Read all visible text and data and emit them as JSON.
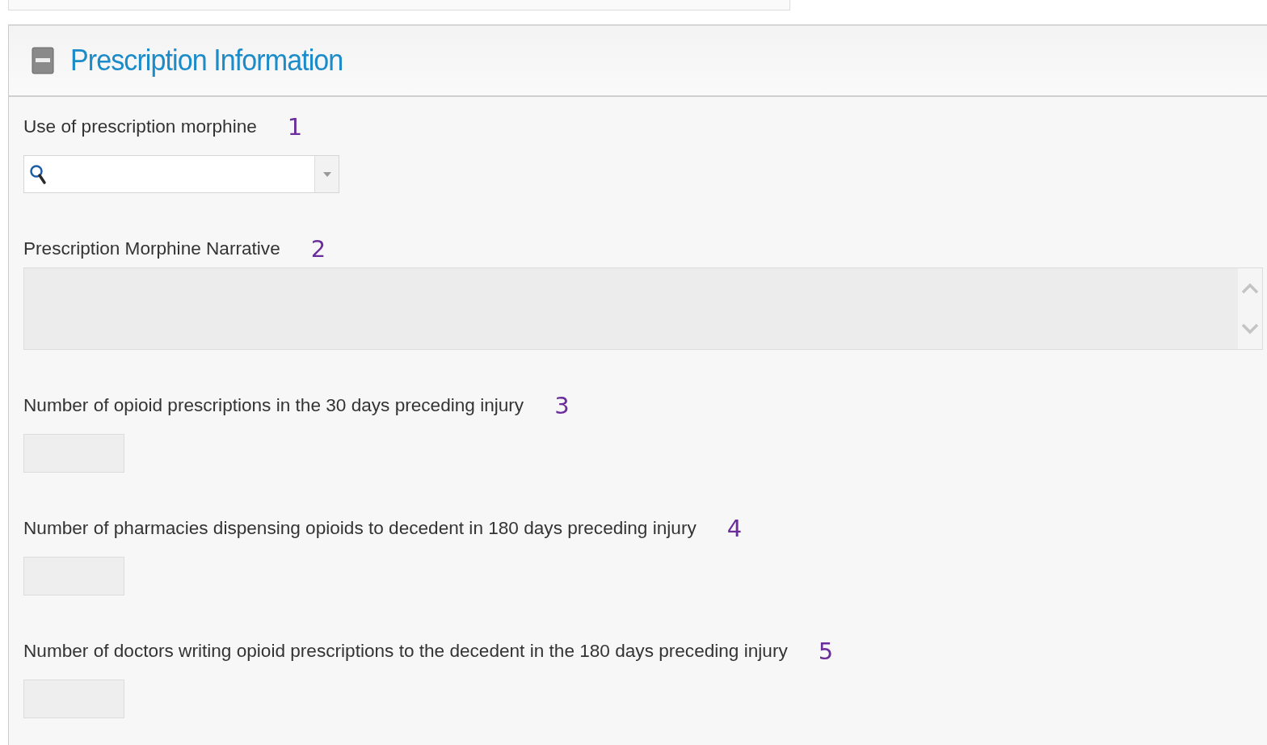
{
  "section": {
    "title": "Prescription Information",
    "expanded": true
  },
  "fields": [
    {
      "kind": "combo",
      "label": "Use of prescription morphine",
      "marker": "1"
    },
    {
      "kind": "textarea",
      "label": "Prescription Morphine Narrative",
      "marker": "2"
    },
    {
      "kind": "number",
      "label": "Number of opioid prescriptions in the 30 days preceding injury",
      "marker": "3"
    },
    {
      "kind": "number",
      "label": "Number of pharmacies dispensing opioids to decedent in 180 days preceding injury",
      "marker": "4"
    },
    {
      "kind": "number",
      "label": "Number of doctors writing opioid prescriptions to the decedent in the 180 days preceding injury",
      "marker": "5"
    }
  ]
}
